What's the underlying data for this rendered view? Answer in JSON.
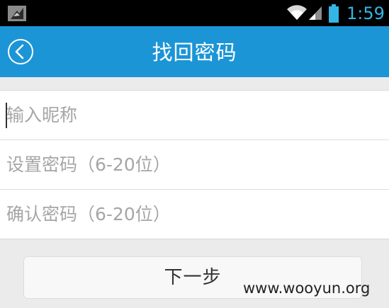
{
  "status_bar": {
    "time": "1:59",
    "icons": [
      "notification-icon",
      "wifi-icon",
      "signal-icon",
      "battery-icon"
    ],
    "time_color": "#33b5e5"
  },
  "header": {
    "title": "找回密码",
    "back_icon": "chevron-left-circle-icon",
    "background_color": "#1b95d6"
  },
  "form": {
    "nickname": {
      "placeholder": "输入昵称",
      "value": ""
    },
    "password": {
      "placeholder": "设置密码（6-20位）",
      "value": ""
    },
    "confirm_password": {
      "placeholder": "确认密码（6-20位）",
      "value": ""
    }
  },
  "next_button": {
    "label": "下一步"
  },
  "watermark": "www.wooyun.org"
}
